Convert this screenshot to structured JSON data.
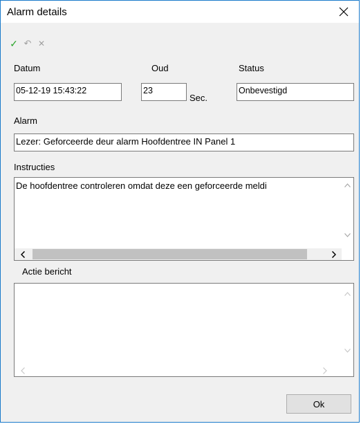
{
  "window": {
    "title": "Alarm details"
  },
  "toolbar": {
    "items": [
      {
        "name": "confirm",
        "glyph": "✓",
        "color": "#2aa52a"
      },
      {
        "name": "undo",
        "glyph": "↶",
        "color": "#a0a0a0"
      },
      {
        "name": "cancel",
        "glyph": "✕",
        "color": "#a0a0a0"
      }
    ]
  },
  "form": {
    "datum_label": "Datum",
    "datum_value": "05-12-19 15:43:22",
    "oud_label": "Oud",
    "oud_value": "23",
    "oud_unit": "Sec.",
    "status_label": "Status",
    "status_value": "Onbevestigd",
    "alarm_label": "Alarm",
    "alarm_value": "Lezer: Geforceerde deur alarm Hoofdentree IN  Panel 1",
    "instructies_label": "Instructies",
    "instructies_value": "De hoofdentree controleren omdat deze een geforceerde meldi",
    "actie_label": "Actie bericht",
    "actie_value": ""
  },
  "buttons": {
    "ok": "Ok"
  }
}
